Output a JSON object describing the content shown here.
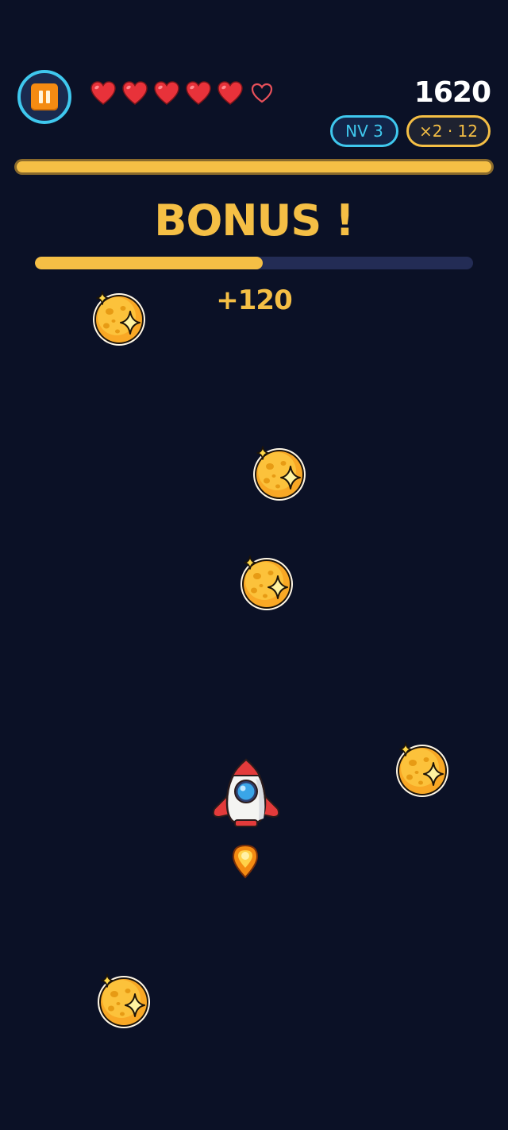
{
  "hud": {
    "pause_icon": "pause-icon",
    "lives": {
      "filled": 5,
      "total": 6
    },
    "score": "1620",
    "level_badge": "NV 3",
    "combo_badge": "×2 · 12",
    "top_progress": 1.0
  },
  "bonus": {
    "title": "BONUS !",
    "progress": 0.52,
    "points": "+120"
  },
  "objects": {
    "coins": 5,
    "player": "rocket-icon",
    "thruster": "flame-icon"
  },
  "colors": {
    "background": "#0b1126",
    "accent_cyan": "#3fc8ee",
    "accent_gold": "#f5bf45",
    "heart_red": "#e8323a",
    "pause_orange": "#f48b12"
  }
}
